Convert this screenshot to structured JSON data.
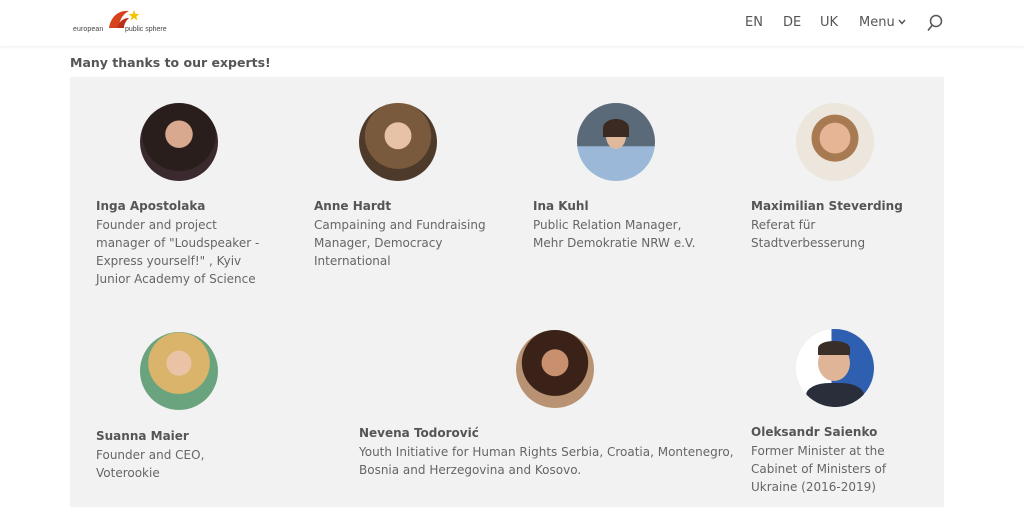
{
  "header": {
    "logo_text_left": "european",
    "logo_text_right": "public sphere",
    "nav": {
      "en": "EN",
      "de": "DE",
      "uk": "UK",
      "menu": "Menu"
    }
  },
  "heading": "Many thanks to our experts!",
  "experts": [
    {
      "name": "Inga Apostolaka",
      "lines": [
        "Founder and project",
        "manager of \"Loudspeaker -",
        "Express yourself!\" , Kyiv",
        "Junior Academy of Science"
      ]
    },
    {
      "name": "Anne Hardt",
      "lines": [
        "Campaining and Fundraising",
        "Manager, Democracy",
        "International"
      ]
    },
    {
      "name": "Ina Kuhl",
      "lines": [
        "Public Relation Manager,",
        "Mehr Demokratie NRW e.V."
      ]
    },
    {
      "name": "Maximilian Steverding",
      "lines": [
        "Referat für",
        "Stadtverbesserung"
      ]
    },
    {
      "name": "Suanna Maier",
      "lines": [
        "Founder and CEO,",
        "Voterookie"
      ]
    },
    {
      "name": "Nevena Todorović",
      "lines": [
        "Youth Initiative for Human Rights Serbia, Croatia, Montenegro,",
        "Bosnia and Herzegovina and Kosovo."
      ]
    },
    {
      "name": "Oleksandr Saienko",
      "lines": [
        "Former Minister at the",
        "Cabinet of Ministers of",
        "Ukraine (2016-2019)"
      ]
    }
  ],
  "colors": {
    "panel": "#f2f2f2",
    "logo_red": "#d6421c",
    "logo_star": "#f5c400"
  }
}
